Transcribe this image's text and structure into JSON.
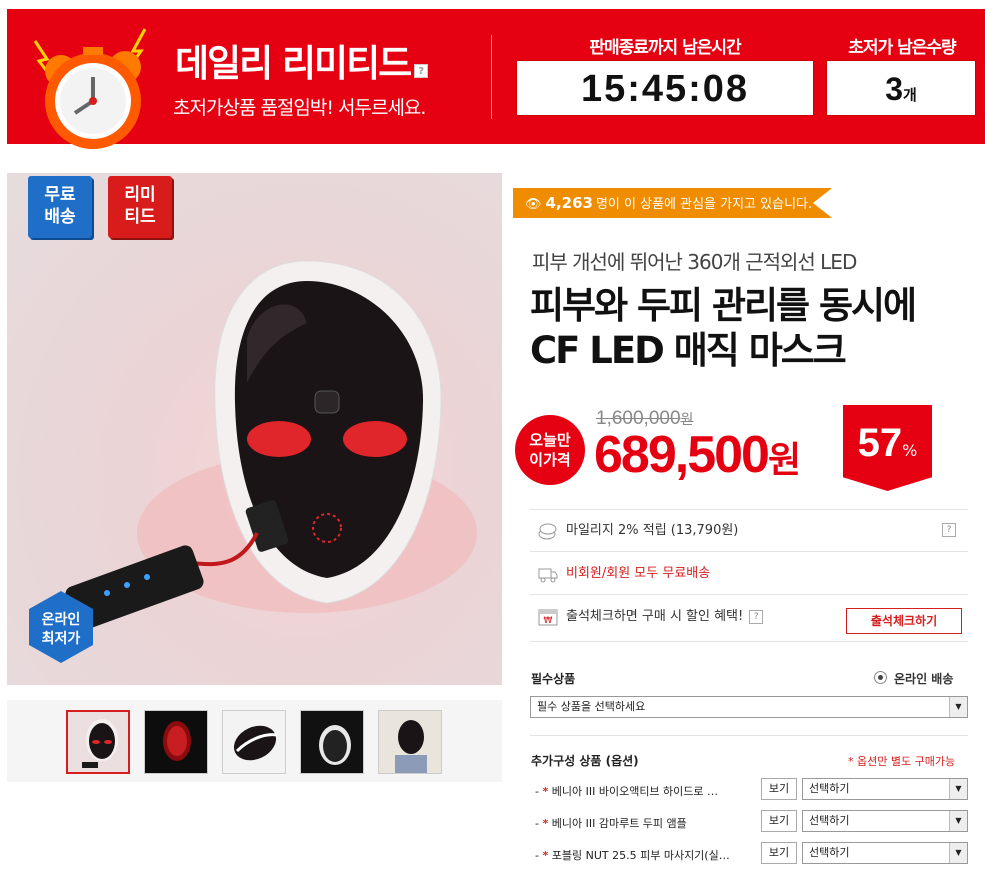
{
  "banner": {
    "title": "데일리 리미티드",
    "help": "?",
    "subtitle": "초저가상품 품절임박! 서두르세요.",
    "timer_label": "판매종료까지 남은시간",
    "timer_value": "15:45:08",
    "qty_label": "초저가 남은수량",
    "qty_value": "3",
    "qty_unit": "개"
  },
  "image": {
    "tag_free": [
      "무료",
      "배송"
    ],
    "tag_limited": [
      "리미",
      "티드"
    ],
    "online_tag": [
      "온라인",
      "최저가"
    ],
    "thumbnails_selected_index": 0
  },
  "product": {
    "views_count": "4,263",
    "views_text": "명이 이 상품에 관심을 가지고 있습니다.",
    "subtitle": "피부 개선에 뛰어난 360개 근적외선 LED",
    "title_line1": "피부와 두피 관리를 동시에",
    "title_line2": "CF LED 매직 마스크",
    "today_label": [
      "오늘만",
      "이가격"
    ],
    "original_price": "1,600,000",
    "original_unit": "원",
    "price": "689,500",
    "price_unit": "원",
    "discount": "57",
    "discount_unit": "%"
  },
  "info": {
    "mileage": "마일리지 2% 적립 (13,790원)",
    "shipping": "비회원/회원 모두 무료배송",
    "attendance": "출석체크하면 구매 시 할인 혜택!",
    "attendance_button": "출석체크하기",
    "help": "?"
  },
  "options": {
    "required_label": "필수상품",
    "delivery_option": "온라인 배송",
    "required_placeholder": "필수 상품을 선택하세요",
    "addon_label": "추가구성 상품 (옵션)",
    "addon_note": "* 옵션만 별도 구매가능",
    "addons": [
      {
        "name": "베니아 III 바이오액티브 하이드로 …",
        "view": "보기",
        "select": "선택하기"
      },
      {
        "name": "베니아 III 감마루트 두피 앰플",
        "view": "보기",
        "select": "선택하기"
      },
      {
        "name": "포블링 NUT 25.5 피부 마사지기(실…",
        "view": "보기",
        "select": "선택하기"
      }
    ],
    "dash": "-",
    "star": "*"
  },
  "colors": {
    "brand_red": "#e50012",
    "accent_orange": "#f08c00",
    "tag_blue": "#1f6fc9"
  }
}
